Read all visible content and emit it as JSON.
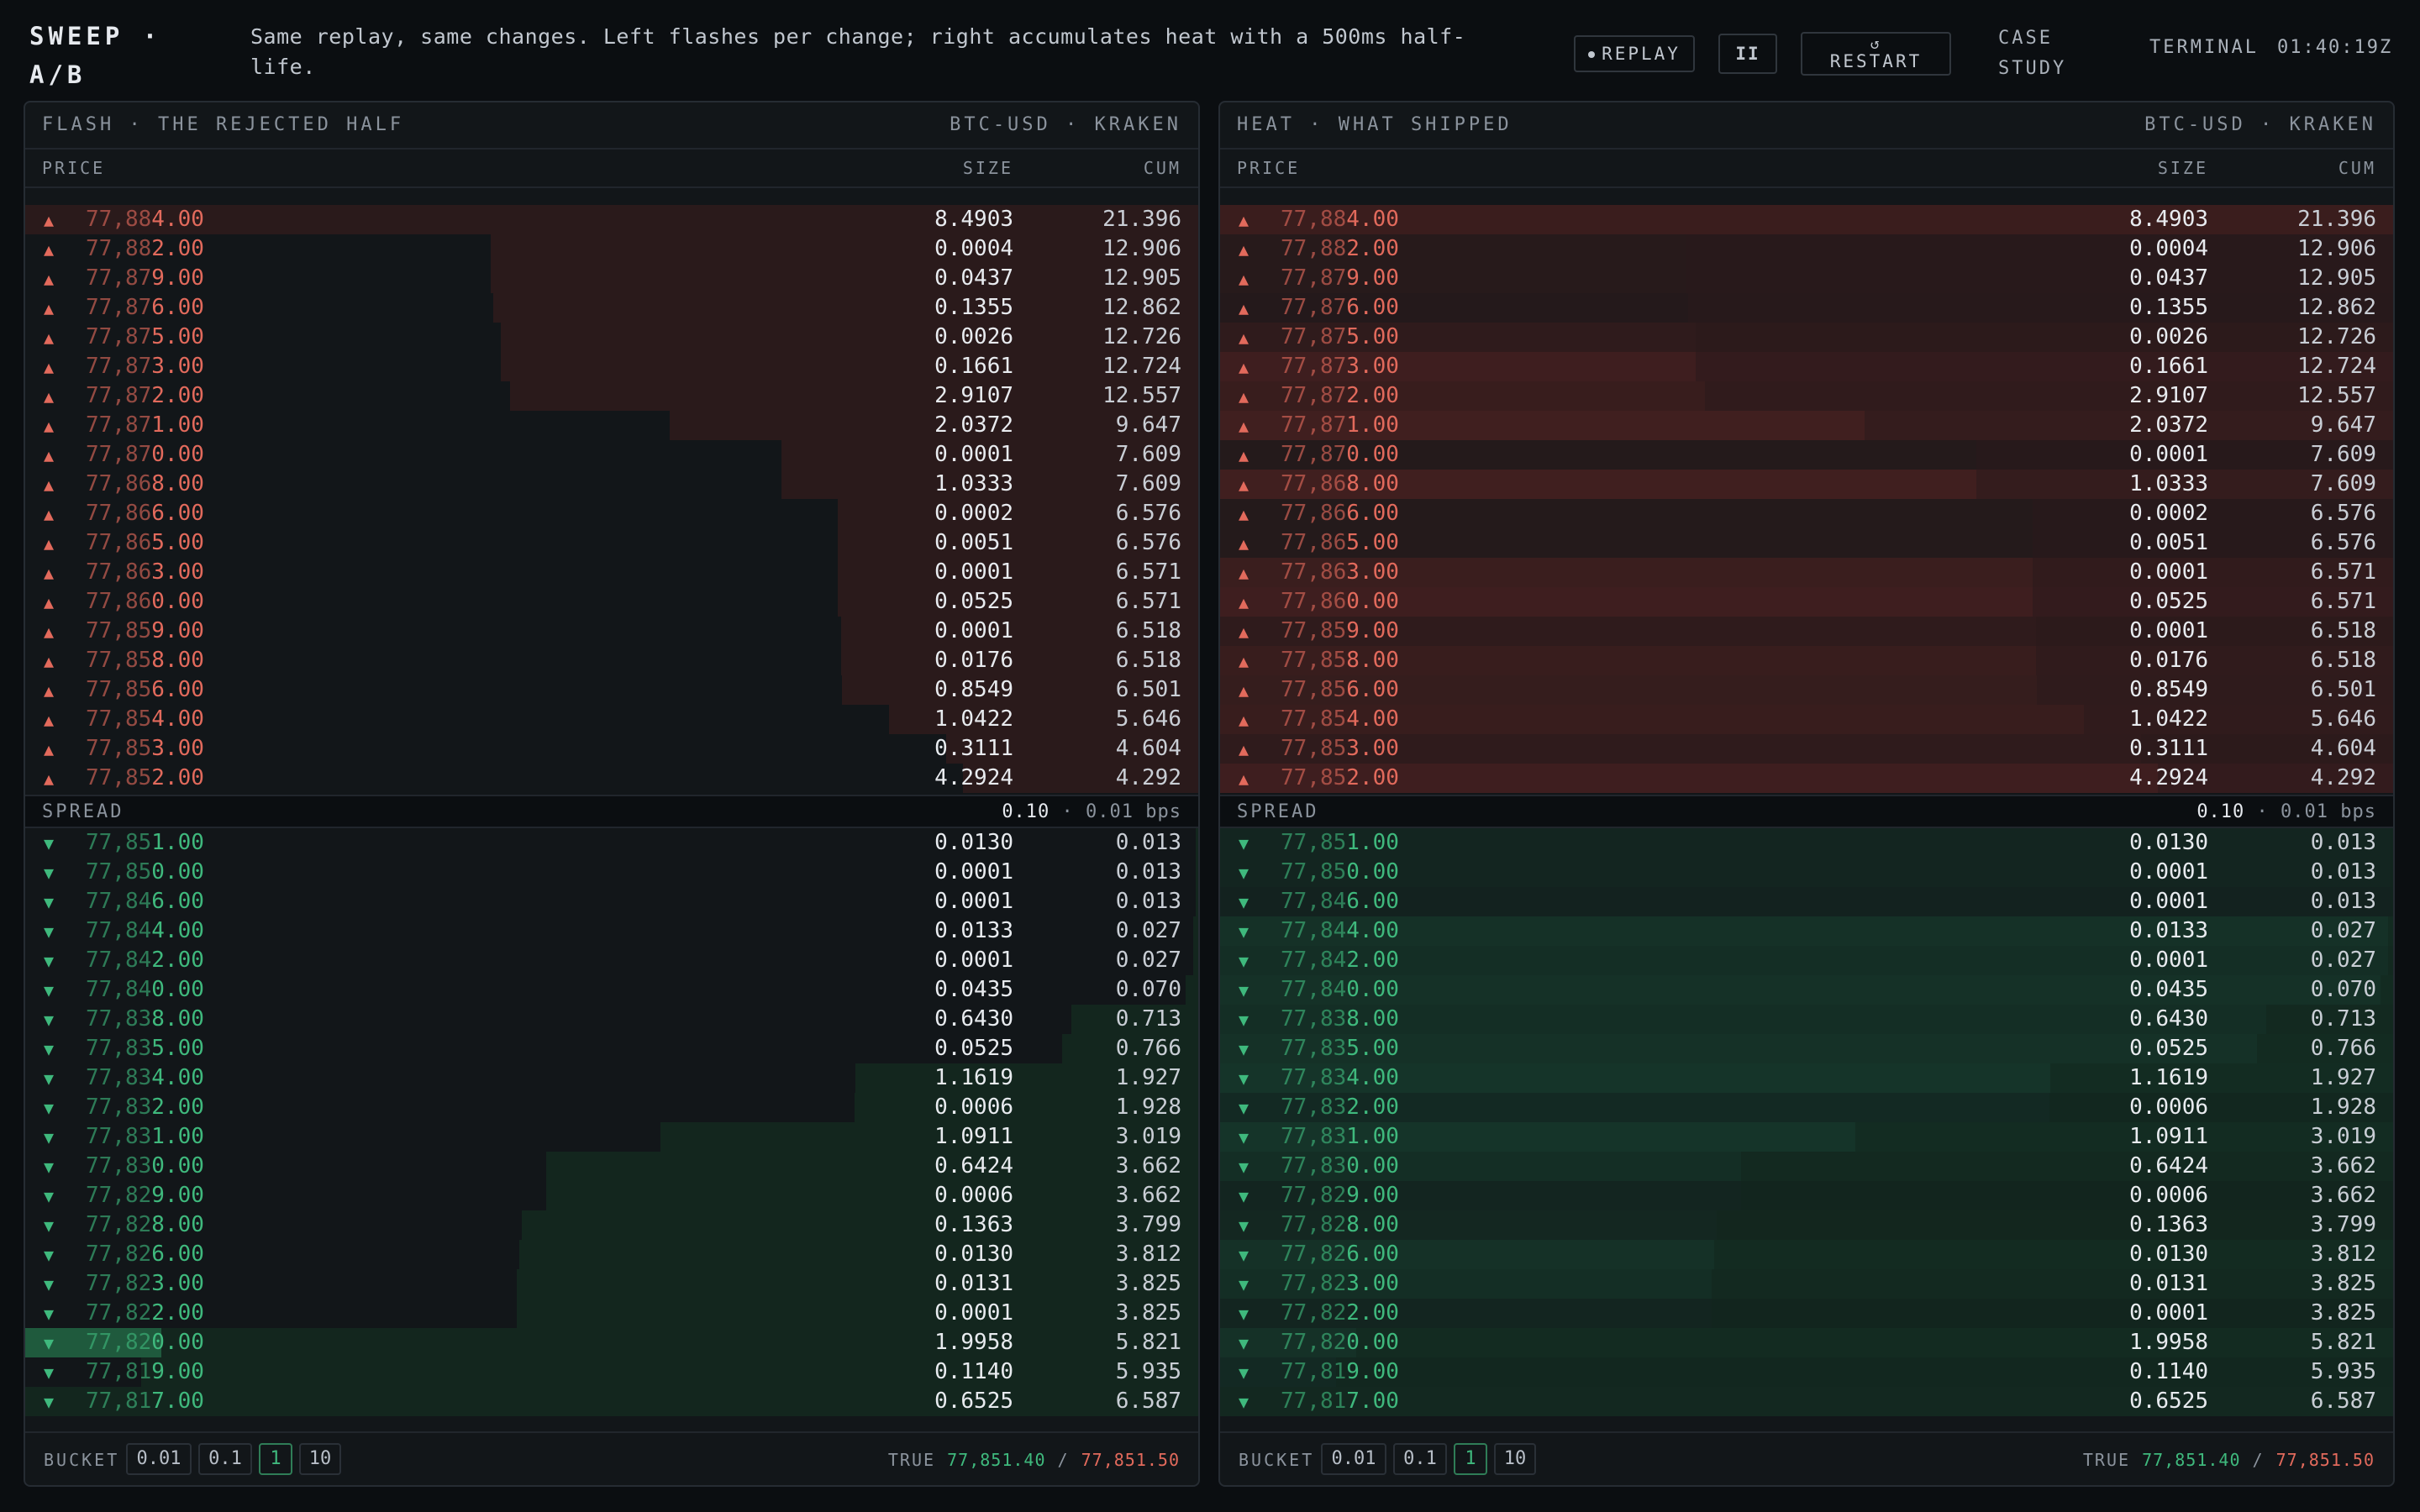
{
  "app": {
    "title": "SWEEP · A/B",
    "tagline": "Same replay, same changes. Left flashes per change; right accumulates heat with a 500ms half-life."
  },
  "toolbar": {
    "replay_label": "REPLAY",
    "pause_label": "II",
    "restart_label": "RESTART",
    "restart_icon": "↺",
    "case_study_label": "CASE STUDY",
    "terminal_label": "TERMINAL",
    "clock": "01:40:19Z"
  },
  "columns": {
    "price": "PRICE",
    "size": "SIZE",
    "cum": "CUM"
  },
  "colors": {
    "ask": "#e26a5c",
    "bid": "#3fb97d",
    "ask_depth": "#2a1a1b",
    "bid_depth": "#13261e",
    "heat_ask": "#7a2b27",
    "heat_bid": "#1c6b46",
    "flash_bid": "#1f5a3d"
  },
  "panels": [
    {
      "id": "flash",
      "title": "FLASH · THE REJECTED HALF",
      "venue": "BTC-USD · KRAKEN",
      "spread_label": "SPREAD",
      "spread_value": "0.10",
      "spread_bps": "· 0.01 bps",
      "bucket_label": "BUCKET",
      "buckets": [
        "0.01",
        "0.1",
        "1",
        "10"
      ],
      "active_bucket": "1",
      "true_label": "TRUE",
      "true_bid": "77,851.40",
      "true_sep": "/",
      "true_ask": "77,851.50"
    },
    {
      "id": "heat",
      "title": "HEAT · WHAT SHIPPED",
      "venue": "BTC-USD · KRAKEN",
      "spread_label": "SPREAD",
      "spread_value": "0.10",
      "spread_bps": "· 0.01 bps",
      "bucket_label": "BUCKET",
      "buckets": [
        "0.01",
        "0.1",
        "1",
        "10"
      ],
      "active_bucket": "1",
      "true_label": "TRUE",
      "true_bid": "77,851.40",
      "true_sep": "/",
      "true_ask": "77,851.50"
    }
  ],
  "asks": [
    {
      "hi": "77,88",
      "lo": "4.00",
      "size": "8.4903",
      "cum": "21.396",
      "cumv": 21.396,
      "heat": 0.85
    },
    {
      "hi": "77,88",
      "lo": "2.00",
      "size": "0.0004",
      "cum": "12.906",
      "cumv": 12.906,
      "heat": 0.15
    },
    {
      "hi": "77,87",
      "lo": "9.00",
      "size": "0.0437",
      "cum": "12.905",
      "cumv": 12.905,
      "heat": 0.15
    },
    {
      "hi": "77,87",
      "lo": "6.00",
      "size": "0.1355",
      "cum": "12.862",
      "cumv": 12.862,
      "heat": 0.12
    },
    {
      "hi": "77,87",
      "lo": "5.00",
      "size": "0.0026",
      "cum": "12.726",
      "cumv": 12.726,
      "heat": 0.3
    },
    {
      "hi": "77,87",
      "lo": "3.00",
      "size": "0.1661",
      "cum": "12.724",
      "cumv": 12.724,
      "heat": 0.55
    },
    {
      "hi": "77,87",
      "lo": "2.00",
      "size": "2.9107",
      "cum": "12.557",
      "cumv": 12.557,
      "heat": 0.45
    },
    {
      "hi": "77,87",
      "lo": "1.00",
      "size": "2.0372",
      "cum": "9.647",
      "cumv": 9.647,
      "heat": 0.6
    },
    {
      "hi": "77,87",
      "lo": "0.00",
      "size": "0.0001",
      "cum": "7.609",
      "cumv": 7.609,
      "heat": 0.1
    },
    {
      "hi": "77,86",
      "lo": "8.00",
      "size": "1.0333",
      "cum": "7.609",
      "cumv": 7.609,
      "heat": 0.6
    },
    {
      "hi": "77,86",
      "lo": "6.00",
      "size": "0.0002",
      "cum": "6.576",
      "cumv": 6.576,
      "heat": 0.1
    },
    {
      "hi": "77,86",
      "lo": "5.00",
      "size": "0.0051",
      "cum": "6.576",
      "cumv": 6.576,
      "heat": 0.1
    },
    {
      "hi": "77,86",
      "lo": "3.00",
      "size": "0.0001",
      "cum": "6.571",
      "cumv": 6.571,
      "heat": 0.5
    },
    {
      "hi": "77,86",
      "lo": "0.00",
      "size": "0.0525",
      "cum": "6.571",
      "cumv": 6.571,
      "heat": 0.55
    },
    {
      "hi": "77,85",
      "lo": "9.00",
      "size": "0.0001",
      "cum": "6.518",
      "cumv": 6.518,
      "heat": 0.3
    },
    {
      "hi": "77,85",
      "lo": "8.00",
      "size": "0.0176",
      "cum": "6.518",
      "cumv": 6.518,
      "heat": 0.45
    },
    {
      "hi": "77,85",
      "lo": "6.00",
      "size": "0.8549",
      "cum": "6.501",
      "cumv": 6.501,
      "heat": 0.4
    },
    {
      "hi": "77,85",
      "lo": "4.00",
      "size": "1.0422",
      "cum": "5.646",
      "cumv": 5.646,
      "heat": 0.45
    },
    {
      "hi": "77,85",
      "lo": "3.00",
      "size": "0.3111",
      "cum": "4.604",
      "cumv": 4.604,
      "heat": 0.3
    },
    {
      "hi": "77,85",
      "lo": "2.00",
      "size": "4.2924",
      "cum": "4.292",
      "cumv": 4.292,
      "heat": 0.55
    }
  ],
  "bids": [
    {
      "hi": "77,85",
      "lo": "1.00",
      "size": "0.0130",
      "cum": "0.013",
      "cumv": 0.013,
      "heat": 0.1
    },
    {
      "hi": "77,85",
      "lo": "0.00",
      "size": "0.0001",
      "cum": "0.013",
      "cumv": 0.013,
      "heat": 0.1
    },
    {
      "hi": "77,84",
      "lo": "6.00",
      "size": "0.0001",
      "cum": "0.013",
      "cumv": 0.013,
      "heat": 0.05
    },
    {
      "hi": "77,84",
      "lo": "4.00",
      "size": "0.0133",
      "cum": "0.027",
      "cumv": 0.027,
      "heat": 0.35
    },
    {
      "hi": "77,84",
      "lo": "2.00",
      "size": "0.0001",
      "cum": "0.027",
      "cumv": 0.027,
      "heat": 0.3
    },
    {
      "hi": "77,84",
      "lo": "0.00",
      "size": "0.0435",
      "cum": "0.070",
      "cumv": 0.07,
      "heat": 0.35
    },
    {
      "hi": "77,83",
      "lo": "8.00",
      "size": "0.6430",
      "cum": "0.713",
      "cumv": 0.713,
      "heat": 0.3
    },
    {
      "hi": "77,83",
      "lo": "5.00",
      "size": "0.0525",
      "cum": "0.766",
      "cumv": 0.766,
      "heat": 0.35
    },
    {
      "hi": "77,83",
      "lo": "4.00",
      "size": "1.1619",
      "cum": "1.927",
      "cumv": 1.927,
      "heat": 0.45
    },
    {
      "hi": "77,83",
      "lo": "2.00",
      "size": "0.0006",
      "cum": "1.928",
      "cumv": 1.928,
      "heat": 0.2
    },
    {
      "hi": "77,83",
      "lo": "1.00",
      "size": "1.0911",
      "cum": "3.019",
      "cumv": 3.019,
      "heat": 0.45
    },
    {
      "hi": "77,83",
      "lo": "0.00",
      "size": "0.6424",
      "cum": "3.662",
      "cumv": 3.662,
      "heat": 0.3
    },
    {
      "hi": "77,82",
      "lo": "9.00",
      "size": "0.0006",
      "cum": "3.662",
      "cumv": 3.662,
      "heat": 0.1
    },
    {
      "hi": "77,82",
      "lo": "8.00",
      "size": "0.1363",
      "cum": "3.799",
      "cumv": 3.799,
      "heat": 0.15
    },
    {
      "hi": "77,82",
      "lo": "6.00",
      "size": "0.0130",
      "cum": "3.812",
      "cumv": 3.812,
      "heat": 0.35
    },
    {
      "hi": "77,82",
      "lo": "3.00",
      "size": "0.0131",
      "cum": "3.825",
      "cumv": 3.825,
      "heat": 0.3
    },
    {
      "hi": "77,82",
      "lo": "2.00",
      "size": "0.0001",
      "cum": "3.825",
      "cumv": 3.825,
      "heat": 0.1
    },
    {
      "hi": "77,82",
      "lo": "0.00",
      "size": "1.9958",
      "cum": "5.821",
      "cumv": 5.821,
      "heat": 0.35,
      "flash": true
    },
    {
      "hi": "77,81",
      "lo": "9.00",
      "size": "0.1140",
      "cum": "5.935",
      "cumv": 5.935,
      "heat": 0.2
    },
    {
      "hi": "77,81",
      "lo": "7.00",
      "size": "0.6525",
      "cum": "6.587",
      "cumv": 6.587,
      "heat": 0.25
    }
  ]
}
